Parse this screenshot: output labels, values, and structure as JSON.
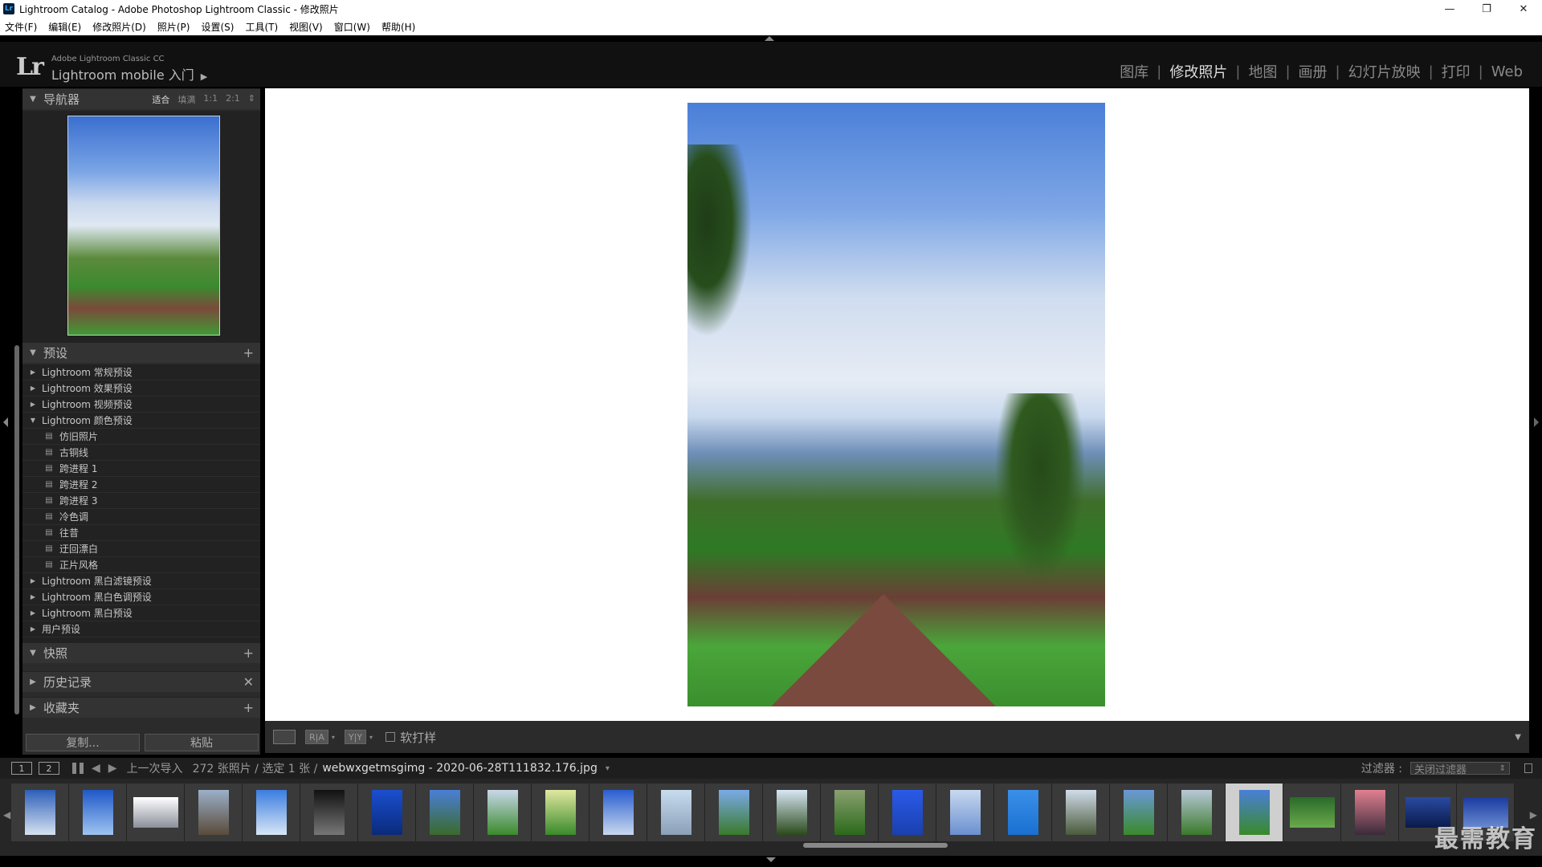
{
  "window": {
    "title": "Lightroom Catalog - Adobe Photoshop Lightroom Classic - 修改照片",
    "app_icon": "Lr",
    "controls": [
      "—",
      "❐",
      "✕"
    ]
  },
  "menu": [
    "文件(F)",
    "编辑(E)",
    "修改照片(D)",
    "照片(P)",
    "设置(S)",
    "工具(T)",
    "视图(V)",
    "窗口(W)",
    "帮助(H)"
  ],
  "identity": {
    "logo": "Lr",
    "small": "Adobe Lightroom Classic CC",
    "big": "Lightroom mobile 入门",
    "arrow": "▶"
  },
  "modules": [
    {
      "label": "图库",
      "active": false
    },
    {
      "label": "修改照片",
      "active": true
    },
    {
      "label": "地图",
      "active": false
    },
    {
      "label": "画册",
      "active": false
    },
    {
      "label": "幻灯片放映",
      "active": false
    },
    {
      "label": "打印",
      "active": false
    },
    {
      "label": "Web",
      "active": false
    }
  ],
  "module_separator": "|",
  "navigator": {
    "title": "导航器",
    "zoom": [
      "适合",
      "填满",
      "1:1",
      "2:1"
    ],
    "zoom_active": "适合",
    "zoom_menu": "⇕"
  },
  "presets": {
    "title": "预设",
    "add": "+",
    "items": [
      {
        "label": "Lightroom 常规预设",
        "level": 0,
        "expanded": false
      },
      {
        "label": "Lightroom 效果预设",
        "level": 0,
        "expanded": false
      },
      {
        "label": "Lightroom 视频预设",
        "level": 0,
        "expanded": false
      },
      {
        "label": "Lightroom 颜色预设",
        "level": 0,
        "expanded": true
      },
      {
        "label": "仿旧照片",
        "level": 1
      },
      {
        "label": "古铜线",
        "level": 1
      },
      {
        "label": "跨进程 1",
        "level": 1
      },
      {
        "label": "跨进程 2",
        "level": 1
      },
      {
        "label": "跨进程 3",
        "level": 1
      },
      {
        "label": "冷色调",
        "level": 1
      },
      {
        "label": "往昔",
        "level": 1
      },
      {
        "label": "迂回漂白",
        "level": 1
      },
      {
        "label": "正片风格",
        "level": 1
      },
      {
        "label": "Lightroom 黑白滤镜预设",
        "level": 0,
        "expanded": false
      },
      {
        "label": "Lightroom 黑白色调预设",
        "level": 0,
        "expanded": false
      },
      {
        "label": "Lightroom 黑白预设",
        "level": 0,
        "expanded": false
      },
      {
        "label": "用户预设",
        "level": 0,
        "expanded": false
      }
    ]
  },
  "snapshots": {
    "title": "快照",
    "add": "+"
  },
  "history": {
    "title": "历史记录",
    "clear": "✕"
  },
  "collections": {
    "title": "收藏夹",
    "add": "+"
  },
  "buttons": {
    "copy": "复制...",
    "paste": "粘贴"
  },
  "toolbar": {
    "ry1": "R|A",
    "ry2": "Y|Y",
    "dropdown": "▾",
    "softproof": "软打样",
    "right_dd": "▼"
  },
  "filmstrip_bar": {
    "screen1": "1",
    "screen2": "2",
    "back": "◀",
    "forward": "▶",
    "source": "上一次导入",
    "count": "272 张照片 / 选定 1 张 /",
    "file": "webwxgetmsgimg - 2020-06-28T111832.176.jpg",
    "file_dd": "▾",
    "filter_label": "过滤器 :",
    "filter_value": "关闭过滤器",
    "filter_dd": "⇕"
  },
  "filmstrip_edges": {
    "left": "◀",
    "right": "▶"
  },
  "thumbs": [
    {
      "c1": "#2d5fb8",
      "c2": "#d6e2f0",
      "wide": false
    },
    {
      "c1": "#1f58c8",
      "c2": "#9fc4f0",
      "wide": false
    },
    {
      "c1": "#ffffff",
      "c2": "#8a8f9a",
      "wide": true
    },
    {
      "c1": "#9bb0c8",
      "c2": "#5a4a3a",
      "wide": false
    },
    {
      "c1": "#3a7de0",
      "c2": "#d8e6f6",
      "wide": false
    },
    {
      "c1": "#111111",
      "c2": "#777777",
      "wide": false
    },
    {
      "c1": "#1a4fd0",
      "c2": "#0a2a7a",
      "wide": false
    },
    {
      "c1": "#4a7fd8",
      "c2": "#3a6a2a",
      "wide": false
    },
    {
      "c1": "#c8d8ea",
      "c2": "#3a8a2a",
      "wide": false
    },
    {
      "c1": "#e0e8a0",
      "c2": "#3a8a2a",
      "wide": false
    },
    {
      "c1": "#2a5ed0",
      "c2": "#c8d8ee",
      "wide": false
    },
    {
      "c1": "#c8dcf0",
      "c2": "#8aa0b8",
      "wide": false
    },
    {
      "c1": "#7aaae8",
      "c2": "#3a7a2a",
      "wide": false
    },
    {
      "c1": "#d8e6f4",
      "c2": "#2a4a1a",
      "wide": false
    },
    {
      "c1": "#8aa070",
      "c2": "#2a6a1a",
      "wide": false
    },
    {
      "c1": "#2a5ae8",
      "c2": "#1a40b0",
      "wide": false
    },
    {
      "c1": "#c8d8f0",
      "c2": "#6a90d0",
      "wide": false
    },
    {
      "c1": "#3a90e8",
      "c2": "#1a70d0",
      "wide": false
    },
    {
      "c1": "#d0dcea",
      "c2": "#4a5a3a",
      "wide": false
    },
    {
      "c1": "#6a98d8",
      "c2": "#3a8a2a",
      "wide": false
    },
    {
      "c1": "#b8c8d8",
      "c2": "#3a7a2a",
      "wide": false
    },
    {
      "c1": "#4a7fd8",
      "c2": "#3a8a2a",
      "wide": false
    },
    {
      "c1": "#2a6a2a",
      "c2": "#6aaa4a",
      "wide": true
    },
    {
      "c1": "#e08090",
      "c2": "#3a2a3a",
      "wide": false
    },
    {
      "c1": "#2a4aa0",
      "c2": "#0a1a4a",
      "wide": true
    },
    {
      "c1": "#1a3aa0",
      "c2": "#6a8ad0",
      "wide": true
    }
  ],
  "selected_thumb": 21,
  "watermark": "最需教育"
}
